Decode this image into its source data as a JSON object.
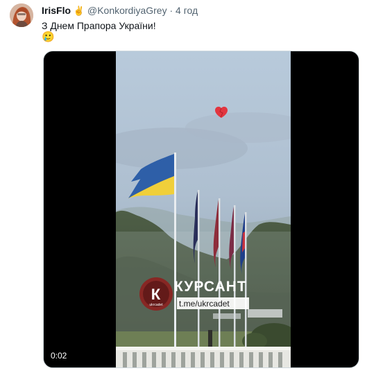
{
  "tweet": {
    "author_name": "IrisFlo",
    "author_emoji": "✌",
    "handle": "@KonkordiyaGrey",
    "separator": "·",
    "time": "4 год",
    "text": "З Днем Прапора України!",
    "emoji": "🥲"
  },
  "media": {
    "duration": "0:02",
    "watermark_title": "КУРСАНТ",
    "watermark_url": "t.me/ukrcadet",
    "watermark_logo_letter": "К",
    "watermark_logo_sub": "ukrcadet"
  }
}
